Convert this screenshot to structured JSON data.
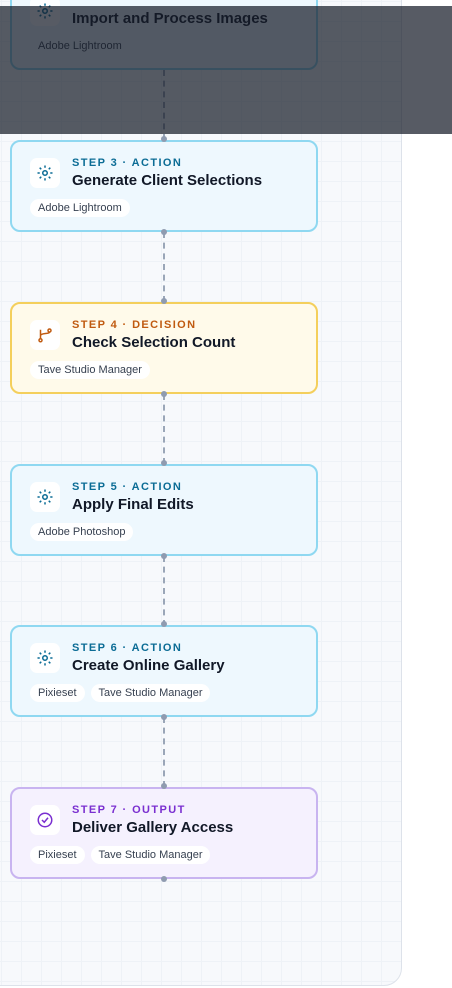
{
  "diagram": {
    "nodes": [
      {
        "kind": "action",
        "icon": "gear-icon",
        "step": "",
        "title": "Import and Process Images",
        "tags": [
          "Adobe Lightroom"
        ]
      },
      {
        "kind": "action",
        "icon": "gear-icon",
        "step": "STEP 3 · ACTION",
        "title": "Generate Client Selections",
        "tags": [
          "Adobe Lightroom"
        ]
      },
      {
        "kind": "decision",
        "icon": "branch-icon",
        "step": "STEP 4 · DECISION",
        "title": "Check Selection Count",
        "tags": [
          "Tave Studio Manager"
        ]
      },
      {
        "kind": "action",
        "icon": "gear-icon",
        "step": "STEP 5 · ACTION",
        "title": "Apply Final Edits",
        "tags": [
          "Adobe Photoshop"
        ]
      },
      {
        "kind": "action",
        "icon": "gear-icon",
        "step": "STEP 6 · ACTION",
        "title": "Create Online Gallery",
        "tags": [
          "Pixieset",
          "Tave Studio Manager"
        ]
      },
      {
        "kind": "output",
        "icon": "check-circle-icon",
        "step": "STEP 7 · OUTPUT",
        "title": "Deliver Gallery Access",
        "tags": [
          "Pixieset",
          "Tave Studio Manager"
        ]
      }
    ],
    "colors": {
      "action_border": "#8fd8f1",
      "decision_border": "#f4cf5c",
      "output_border": "#c8b4f0",
      "overlay": "#161c28"
    }
  }
}
